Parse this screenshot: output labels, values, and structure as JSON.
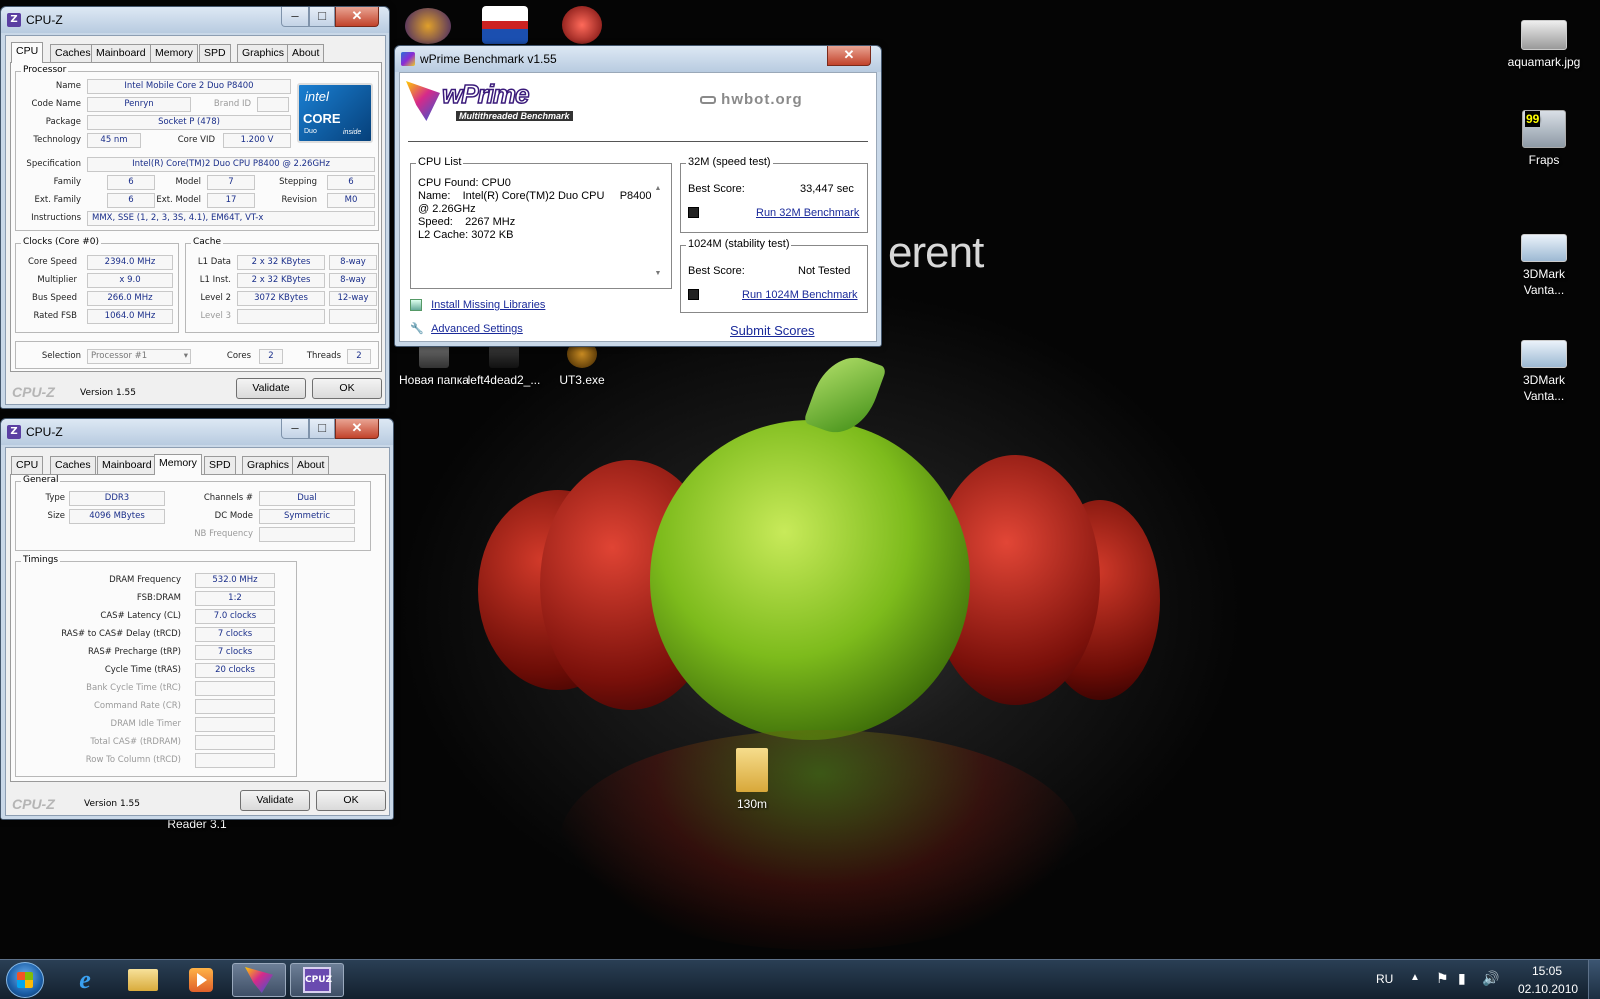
{
  "desktop": {
    "wallpaper_text": "erent",
    "icons": [
      {
        "label": "aquamark.jpg",
        "icon": "image-thumbnail-icon"
      },
      {
        "label": "Fraps",
        "icon": "fraps-icon"
      },
      {
        "label": "3DMark Vanta...",
        "icon": "3dmark-icon"
      },
      {
        "label": "3DMark Vanta...",
        "icon": "3dmark-icon"
      },
      {
        "label": "Новая папка",
        "icon": "folder-icon"
      },
      {
        "label": "left4dead2_...",
        "icon": "shortcut-icon"
      },
      {
        "label": "UT3.exe",
        "icon": "ut3-icon"
      },
      {
        "label": "130m",
        "icon": "folder-icon"
      },
      {
        "label": "Reader 3.1",
        "icon": "reader-icon"
      }
    ]
  },
  "cpuz1": {
    "title": "CPU-Z",
    "tabs": [
      "CPU",
      "Caches",
      "Mainboard",
      "Memory",
      "SPD",
      "Graphics",
      "About"
    ],
    "selected_tab": "CPU",
    "processor": {
      "group": "Processor",
      "name_label": "Name",
      "name": "Intel Mobile Core 2 Duo P8400",
      "codename_label": "Code Name",
      "codename": "Penryn",
      "brandid_label": "Brand ID",
      "package_label": "Package",
      "package": "Socket P (478)",
      "technology_label": "Technology",
      "technology": "45 nm",
      "corevid_label": "Core VID",
      "corevid": "1.200 V",
      "spec_label": "Specification",
      "spec": "Intel(R) Core(TM)2 Duo CPU     P8400  @ 2.26GHz",
      "family_label": "Family",
      "family": "6",
      "model_label": "Model",
      "model": "7",
      "stepping_label": "Stepping",
      "stepping": "6",
      "extfamily_label": "Ext. Family",
      "extfamily": "6",
      "extmodel_label": "Ext. Model",
      "extmodel": "17",
      "revision_label": "Revision",
      "revision": "M0",
      "instr_label": "Instructions",
      "instructions": "MMX, SSE (1, 2, 3, 3S, 4.1), EM64T, VT-x",
      "logo_top": "intel",
      "logo_core": "CORE",
      "logo_duo": "Duo",
      "logo_inside": "inside"
    },
    "clocks": {
      "group": "Clocks (Core #0)",
      "corespeed_label": "Core Speed",
      "corespeed": "2394.0 MHz",
      "multiplier_label": "Multiplier",
      "multiplier": "x 9.0",
      "busspeed_label": "Bus Speed",
      "busspeed": "266.0 MHz",
      "ratedfsb_label": "Rated FSB",
      "ratedfsb": "1064.0 MHz"
    },
    "cache": {
      "group": "Cache",
      "l1data_label": "L1 Data",
      "l1data": "2 x 32 KBytes",
      "l1data_way": "8-way",
      "l1inst_label": "L1 Inst.",
      "l1inst": "2 x 32 KBytes",
      "l1inst_way": "8-way",
      "level2_label": "Level 2",
      "level2": "3072 KBytes",
      "level2_way": "12-way",
      "level3_label": "Level 3"
    },
    "selection_label": "Selection",
    "selection": "Processor #1",
    "cores_label": "Cores",
    "cores": "2",
    "threads_label": "Threads",
    "threads": "2",
    "brand": "CPU-Z",
    "version": "Version 1.55",
    "validate": "Validate",
    "ok": "OK"
  },
  "cpuz2": {
    "title": "CPU-Z",
    "tabs": [
      "CPU",
      "Caches",
      "Mainboard",
      "Memory",
      "SPD",
      "Graphics",
      "About"
    ],
    "selected_tab": "Memory",
    "general": {
      "group": "General",
      "type_label": "Type",
      "type": "DDR3",
      "size_label": "Size",
      "size": "4096 MBytes",
      "channels_label": "Channels #",
      "channels": "Dual",
      "dcmode_label": "DC Mode",
      "dcmode": "Symmetric",
      "nbfreq_label": "NB Frequency"
    },
    "timings": {
      "group": "Timings",
      "rows": [
        {
          "label": "DRAM Frequency",
          "value": "532.0 MHz",
          "enabled": true
        },
        {
          "label": "FSB:DRAM",
          "value": "1:2",
          "enabled": true
        },
        {
          "label": "CAS# Latency (CL)",
          "value": "7.0 clocks",
          "enabled": true
        },
        {
          "label": "RAS# to CAS# Delay (tRCD)",
          "value": "7 clocks",
          "enabled": true
        },
        {
          "label": "RAS# Precharge (tRP)",
          "value": "7 clocks",
          "enabled": true
        },
        {
          "label": "Cycle Time (tRAS)",
          "value": "20 clocks",
          "enabled": true
        },
        {
          "label": "Bank Cycle Time (tRC)",
          "value": "",
          "enabled": false
        },
        {
          "label": "Command Rate (CR)",
          "value": "",
          "enabled": false
        },
        {
          "label": "DRAM Idle Timer",
          "value": "",
          "enabled": false
        },
        {
          "label": "Total CAS# (tRDRAM)",
          "value": "",
          "enabled": false
        },
        {
          "label": "Row To Column (tRCD)",
          "value": "",
          "enabled": false
        }
      ]
    },
    "brand": "CPU-Z",
    "version": "Version 1.55",
    "validate": "Validate",
    "ok": "OK"
  },
  "wprime": {
    "title": "wPrime Benchmark v1.55",
    "logo": "wPrime",
    "logo_sub": "Multithreaded Benchmark",
    "hwbot": "hwbot.org",
    "cpulist_label": "CPU List",
    "cpulist_lines": [
      "CPU Found: CPU0",
      "Name:    Intel(R) Core(TM)2 Duo CPU     P8400",
      "@ 2.26GHz",
      "Speed:    2267 MHz",
      "L2 Cache: 3072 KB"
    ],
    "install_libs": "Install Missing Libraries",
    "advanced": "Advanced Settings",
    "test32": {
      "group": "32M (speed test)",
      "best_label": "Best Score:",
      "best": "33,447 sec",
      "run": "Run 32M Benchmark"
    },
    "test1024": {
      "group": "1024M (stability test)",
      "best_label": "Best Score:",
      "best": "Not Tested",
      "run": "Run 1024M Benchmark"
    },
    "submit": "Submit Scores"
  },
  "taskbar": {
    "lang": "RU",
    "time": "15:05",
    "date": "02.10.2010"
  },
  "colors": {
    "taskbar": "#1c2d40",
    "cpuz_value": "#1a2e8a",
    "intel_blue": "#0860a8",
    "link": "#1a2a9a"
  }
}
